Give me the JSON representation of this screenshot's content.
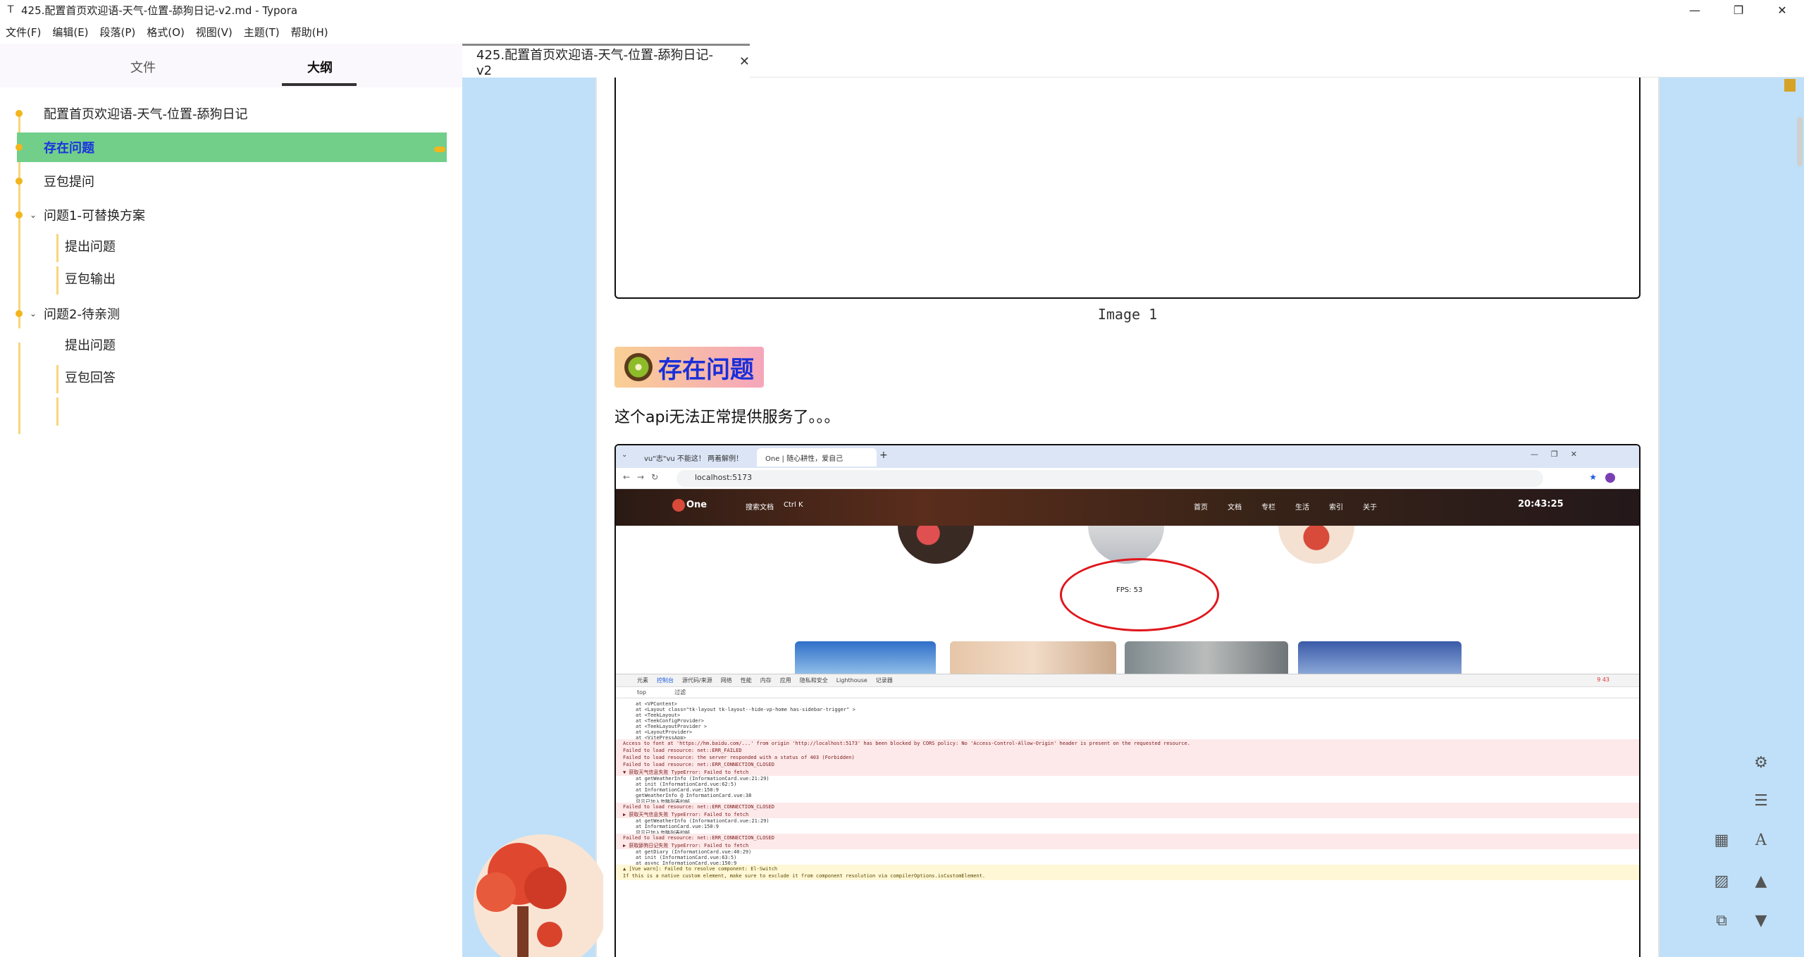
{
  "window": {
    "title": "425.配置首页欢迎语-天气-位置-舔狗日记-v2.md - Typora",
    "minimize": "—",
    "maximize": "❐",
    "close": "✕"
  },
  "menubar": {
    "items": [
      "文件(F)",
      "编辑(E)",
      "段落(P)",
      "格式(O)",
      "视图(V)",
      "主题(T)",
      "帮助(H)"
    ]
  },
  "sidebar": {
    "tabs": {
      "files": "文件",
      "outline": "大纲"
    },
    "outline": [
      {
        "label": "配置首页欢迎语-天气-位置-舔狗日记",
        "level": 1
      },
      {
        "label": "存在问题",
        "level": 1,
        "active": true
      },
      {
        "label": "豆包提问",
        "level": 1
      },
      {
        "label": "问题1-可替换方案",
        "level": 1,
        "expanded": true
      },
      {
        "label": "提出问题",
        "level": 2
      },
      {
        "label": "豆包输出",
        "level": 2
      },
      {
        "label": "问题2-待亲测",
        "level": 1,
        "expanded": true
      },
      {
        "label": "提出问题",
        "level": 2
      },
      {
        "label": "豆包回答",
        "level": 2
      }
    ]
  },
  "editor": {
    "tab_label": "425.配置首页欢迎语-天气-位置-舔狗日记-v2",
    "tab_close": "✕",
    "image_caption": "Image 1",
    "heading": "存在问题",
    "paragraph": "这个api无法正常提供服务了。。。"
  },
  "screenshot": {
    "tabs": [
      "vu\"志\"vu 不能这！ 两着解例！",
      "One | 随心耕性，爱自己"
    ],
    "url": "localhost:5173",
    "site_brand": "One",
    "site_search": "搜索文档",
    "site_shortcut": "Ctrl K",
    "site_nav": [
      "首页",
      "文档",
      "专栏",
      "生活",
      "索引",
      "关于"
    ],
    "clock": "20:43:25",
    "fps": "FPS: 53",
    "devtools_tabs": [
      "元素",
      "控制台",
      "源代码/来源",
      "网络",
      "性能",
      "内存",
      "应用",
      "隐私和安全",
      "Lighthouse",
      "记录器"
    ],
    "devtools_filter": [
      "top",
      "过滤"
    ],
    "devtools_counts": "9 43",
    "log_lines": [
      {
        "kind": "stack",
        "text": "at <VPContent>"
      },
      {
        "kind": "stack",
        "text": "at <Layout class=\"tk-layout tk-layout--hide-vp-home has-sidebar-trigger\" >"
      },
      {
        "kind": "stack",
        "text": "at <TeekLayout>"
      },
      {
        "kind": "stack",
        "text": "at <TeekConfigProvider>"
      },
      {
        "kind": "stack",
        "text": "at <TeekLayoutProvider >"
      },
      {
        "kind": "stack",
        "text": "at <LayoutProvider>"
      },
      {
        "kind": "stack",
        "text": "at <VitePressApp>"
      },
      {
        "kind": "error",
        "text": "Access to font at 'https://hm.baidu.com/...' from origin 'http://localhost:5173' has been blocked by CORS policy: No 'Access-Control-Allow-Origin' header is present on the requested resource."
      },
      {
        "kind": "error",
        "text": "Failed to load resource: net::ERR_FAILED"
      },
      {
        "kind": "error",
        "text": "Failed to load resource: the server responded with a status of 403 (Forbidden)"
      },
      {
        "kind": "error",
        "text": "Failed to load resource: net::ERR_CONNECTION_CLOSED"
      },
      {
        "kind": "error",
        "text": "▼ 获取天气信息失败 TypeError: Failed to fetch"
      },
      {
        "kind": "stack",
        "text": "at getWeatherInfo (InformationCard.vue:21:29)"
      },
      {
        "kind": "stack",
        "text": "at init (InformationCard.vue:62:5)"
      },
      {
        "kind": "stack",
        "text": "at InformationCard.vue:150:9"
      },
      {
        "kind": "stack",
        "text": "getWeatherInfo @ InformationCard.vue:38"
      },
      {
        "kind": "stack",
        "text": "显示已加入忽略列表的帧"
      },
      {
        "kind": "error",
        "text": "Failed to load resource: net::ERR_CONNECTION_CLOSED"
      },
      {
        "kind": "error",
        "text": "▶ 获取天气信息失败 TypeError: Failed to fetch"
      },
      {
        "kind": "stack",
        "text": "at getWeatherInfo (InformationCard.vue:21:29)"
      },
      {
        "kind": "stack",
        "text": "at InformationCard.vue:150:9"
      },
      {
        "kind": "stack",
        "text": "显示已加入忽略列表的帧"
      },
      {
        "kind": "error",
        "text": "Failed to load resource: net::ERR_CONNECTION_CLOSED"
      },
      {
        "kind": "error",
        "text": "▶ 获取舔狗日记失败 TypeError: Failed to fetch"
      },
      {
        "kind": "stack",
        "text": "at getDiary (InformationCard.vue:40:29)"
      },
      {
        "kind": "stack",
        "text": "at init (InformationCard.vue:63:5)"
      },
      {
        "kind": "stack",
        "text": "at async InformationCard.vue:150:9"
      },
      {
        "kind": "warn",
        "text": "▲ [Vue warn]: Failed to resolve component: El-Switch"
      },
      {
        "kind": "warn",
        "text": "If this is a native custom element, make sure to exclude it from component resolution via compilerOptions.isCustomElement."
      }
    ]
  },
  "tools": [
    "gear-icon",
    "outline-icon",
    "table-icon",
    "font-icon",
    "image-icon",
    "arrow-up-icon",
    "sitemap-icon",
    "arrow-down-icon"
  ],
  "colors": {
    "outline_active": "#72cf8a",
    "outline_active_text": "#1a33e0",
    "outline_dot": "#f2b51d",
    "editor_bg": "#bfe0f8",
    "heading_text": "#1a2fd8"
  }
}
